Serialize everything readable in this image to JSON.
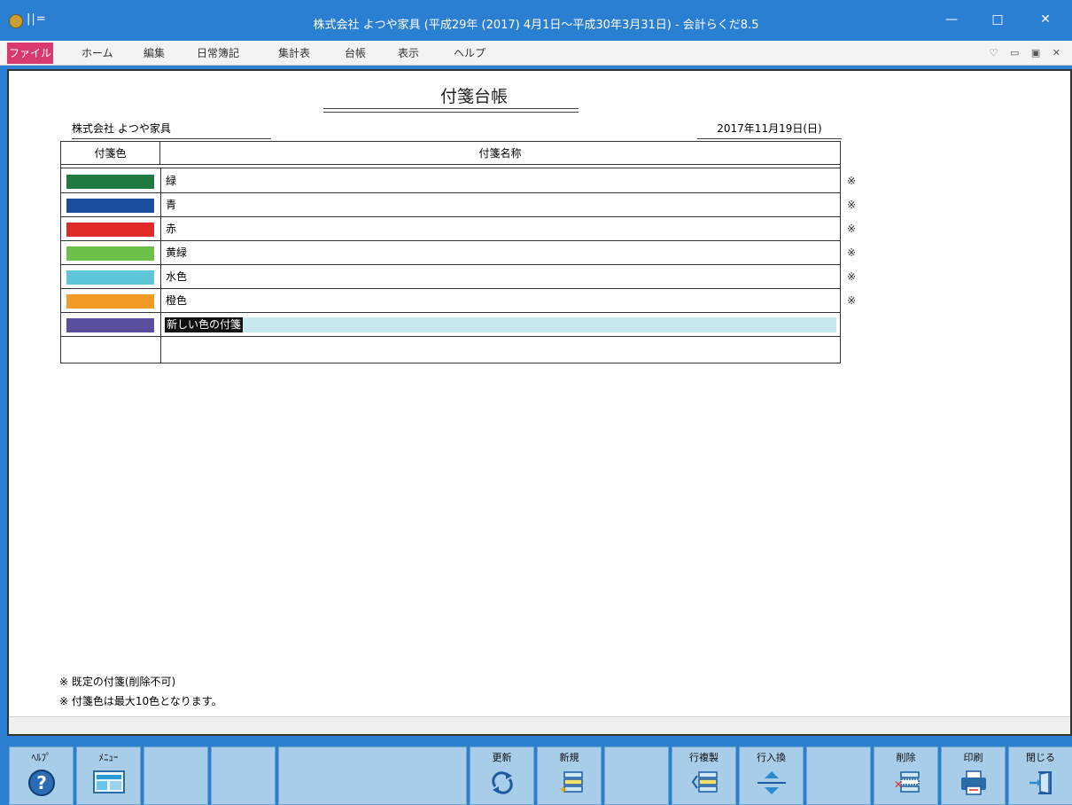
{
  "window": {
    "quick_access": "||=",
    "title": "株式会社 よつや家具 (平成29年 (2017) 4月1日～平成30年3月31日) - 会計らくだ8.5",
    "minimize": "—",
    "maximize": "□",
    "close": "✕"
  },
  "menubar": {
    "file": "ファイル",
    "items": [
      "ホーム",
      "編集",
      "日常簿記",
      "集計表",
      "台帳",
      "表示",
      "ヘルプ"
    ],
    "right": "♡ ▭ ▣ ✕"
  },
  "ledger": {
    "title": "付箋台帳",
    "company": "株式会社 よつや家具",
    "date": "2017年11月19日(日)",
    "headers": {
      "color": "付箋色",
      "name": "付箋名称"
    },
    "rows": [
      {
        "color": "#1f7a3f",
        "name": "緑",
        "builtin": "※"
      },
      {
        "color": "#1b4f9e",
        "name": "青",
        "builtin": "※"
      },
      {
        "color": "#e02a2a",
        "name": "赤",
        "builtin": "※"
      },
      {
        "color": "#6cc04a",
        "name": "黄緑",
        "builtin": "※"
      },
      {
        "color": "#5ec6d8",
        "name": "水色",
        "builtin": "※"
      },
      {
        "color": "#f39a26",
        "name": "橙色",
        "builtin": "※"
      },
      {
        "color": "#5a4f9e",
        "name": "新しい色の付箋",
        "builtin": ""
      }
    ],
    "notes": [
      "※ 既定の付箋(削除不可)",
      "※ 付箋色は最大10色となります。"
    ]
  },
  "fkeys": {
    "help": "ﾍﾙﾌﾟ",
    "menu": "ﾒﾆｭｰ",
    "update": "更新",
    "new": "新規",
    "copy_row": "行複製",
    "swap_row": "行入換",
    "delete": "削除",
    "print": "印刷",
    "close": "閉じる"
  }
}
